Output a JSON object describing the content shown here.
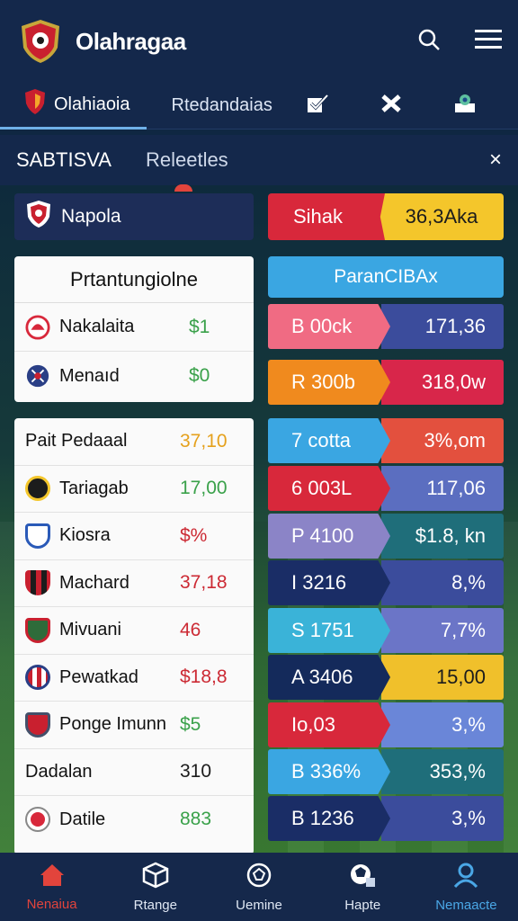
{
  "app": {
    "title": "Olahragaa"
  },
  "tabs": [
    {
      "label": "Olahiaoia"
    },
    {
      "label": "Rtedandaias"
    }
  ],
  "subbar": {
    "title": "SABTISVA",
    "tab": "Releetles",
    "close": "×"
  },
  "header_left": {
    "team": "Napola"
  },
  "header_right": {
    "left": "Sihak",
    "right": "36,3Aka"
  },
  "block1": {
    "title": "Prtantungiolne",
    "rows": [
      {
        "name": "Nakalaita",
        "value": "$1",
        "color": "#3aa14a"
      },
      {
        "name": "Menaıd",
        "value": "$0",
        "color": "#3aa14a"
      }
    ]
  },
  "block2": {
    "rows": [
      {
        "name": "Pait Pedaaal",
        "value": "37,10",
        "color": "#e5a11d"
      },
      {
        "name": "Tariagab",
        "value": "17,00",
        "color": "#3aa14a"
      },
      {
        "name": "Kiosra",
        "value": "$%",
        "color": "#cc2a34"
      },
      {
        "name": "Machard",
        "value": "37,18",
        "color": "#cc2a34"
      },
      {
        "name": "Mivuani",
        "value": "46",
        "color": "#cc2a34"
      },
      {
        "name": "Pewatkad",
        "value": "$18,8",
        "color": "#cc2a34"
      },
      {
        "name": "Ponge Imunn",
        "value": "$5",
        "color": "#3aa14a"
      },
      {
        "name": "Dadalan",
        "value": "310",
        "color": "#1c1c1c"
      },
      {
        "name": "Datile",
        "value": "883",
        "color": "#3aa14a"
      }
    ]
  },
  "right_header": {
    "label": "ParanCIBAx"
  },
  "right_rows": [
    {
      "left": "B 00ck",
      "right": "171,36",
      "ca": "#f06b83",
      "cb": "#3b4c9c"
    },
    {
      "left": "R 300b",
      "right": "318,0w",
      "ca": "#f08a1e",
      "cb": "#d8264a"
    },
    {
      "left": "7 cotta",
      "right": "3%,om",
      "ca": "#3aa6e2",
      "cb": "#e3503e"
    },
    {
      "left": "6 003L",
      "right": "117,06",
      "ca": "#d8283b",
      "cb": "#5b6ec0"
    },
    {
      "left": "P 4100",
      "right": "$1.8, kn",
      "ca": "#8b84c7",
      "cb": "#1f6e7a"
    },
    {
      "left": "I 3216",
      "right": "8,%",
      "ca": "#1a2d66",
      "cb": "#3b4c9c"
    },
    {
      "left": "S 1751",
      "right": "7,7%",
      "ca": "#3ab3d8",
      "cb": "#6b75c7"
    },
    {
      "left": "A 3406",
      "right": "15,00",
      "ca": "#142a5b",
      "cb": "#f0c02b"
    },
    {
      "left": "Io,03",
      "right": "3,%",
      "ca": "#d8283b",
      "cb": "#6a86d8"
    },
    {
      "left": "B 336%",
      "right": "353,%",
      "ca": "#3aa6e2",
      "cb": "#1f6e7a"
    },
    {
      "left": "B 1236",
      "right": "3,%",
      "ca": "#1a2d66",
      "cb": "#3b4c9c"
    }
  ],
  "nav": [
    {
      "label": "Nenaiua",
      "icon": "home-icon"
    },
    {
      "label": "Rtange",
      "icon": "box-icon"
    },
    {
      "label": "Uemine",
      "icon": "ball-icon"
    },
    {
      "label": "Hapte",
      "icon": "stats-icon"
    },
    {
      "label": "Nemaacte",
      "icon": "profile-icon"
    }
  ]
}
